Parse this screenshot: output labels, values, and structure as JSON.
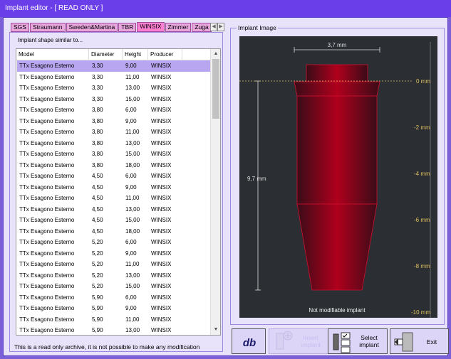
{
  "window": {
    "title": "Implant editor  -  [ READ ONLY ]"
  },
  "tabs": [
    {
      "label": "SGS",
      "active": false
    },
    {
      "label": "Straumann",
      "active": false
    },
    {
      "label": "Sweden&Martina",
      "active": false
    },
    {
      "label": "TBR",
      "active": false
    },
    {
      "label": "WINSIX",
      "active": true
    },
    {
      "label": "Zimmer",
      "active": false
    },
    {
      "label": "Zuga",
      "active": false
    }
  ],
  "left": {
    "subtitle": "Implant shape similar to...",
    "columns": [
      "Model",
      "Diameter",
      "Height",
      "Producer"
    ],
    "rows": [
      [
        "TTx Esagono Esterno",
        "3,30",
        "9,00",
        "WINSIX"
      ],
      [
        "TTx Esagono Esterno",
        "3,30",
        "11,00",
        "WINSIX"
      ],
      [
        "TTx Esagono Esterno",
        "3,30",
        "13,00",
        "WINSIX"
      ],
      [
        "TTx Esagono Esterno",
        "3,30",
        "15,00",
        "WINSIX"
      ],
      [
        "TTx Esagono Esterno",
        "3,80",
        "6,00",
        "WINSIX"
      ],
      [
        "TTx Esagono Esterno",
        "3,80",
        "9,00",
        "WINSIX"
      ],
      [
        "TTx Esagono Esterno",
        "3,80",
        "11,00",
        "WINSIX"
      ],
      [
        "TTx Esagono Esterno",
        "3,80",
        "13,00",
        "WINSIX"
      ],
      [
        "TTx Esagono Esterno",
        "3,80",
        "15,00",
        "WINSIX"
      ],
      [
        "TTx Esagono Esterno",
        "3,80",
        "18,00",
        "WINSIX"
      ],
      [
        "TTx Esagono Esterno",
        "4,50",
        "6,00",
        "WINSIX"
      ],
      [
        "TTx Esagono Esterno",
        "4,50",
        "9,00",
        "WINSIX"
      ],
      [
        "TTx Esagono Esterno",
        "4,50",
        "11,00",
        "WINSIX"
      ],
      [
        "TTx Esagono Esterno",
        "4,50",
        "13,00",
        "WINSIX"
      ],
      [
        "TTx Esagono Esterno",
        "4,50",
        "15,00",
        "WINSIX"
      ],
      [
        "TTx Esagono Esterno",
        "4,50",
        "18,00",
        "WINSIX"
      ],
      [
        "TTx Esagono Esterno",
        "5,20",
        "6,00",
        "WINSIX"
      ],
      [
        "TTx Esagono Esterno",
        "5,20",
        "9,00",
        "WINSIX"
      ],
      [
        "TTx Esagono Esterno",
        "5,20",
        "11,00",
        "WINSIX"
      ],
      [
        "TTx Esagono Esterno",
        "5,20",
        "13,00",
        "WINSIX"
      ],
      [
        "TTx Esagono Esterno",
        "5,20",
        "15,00",
        "WINSIX"
      ],
      [
        "TTx Esagono Esterno",
        "5,90",
        "6,00",
        "WINSIX"
      ],
      [
        "TTx Esagono Esterno",
        "5,90",
        "9,00",
        "WINSIX"
      ],
      [
        "TTx Esagono Esterno",
        "5,90",
        "11,00",
        "WINSIX"
      ],
      [
        "TTx Esagono Esterno",
        "5,90",
        "13,00",
        "WINSIX"
      ]
    ],
    "selected_row": 0,
    "note": "This is a read only archive, it is not possible to make any modification"
  },
  "image_panel": {
    "title": "Implant Image",
    "width_label": "3,7 mm",
    "height_label": "9,7 mm",
    "scale_labels": [
      "0 mm",
      "-2 mm",
      "-4 mm",
      "-6 mm",
      "-8 mm",
      "-10 mm"
    ],
    "caption": "Not modifiable implant"
  },
  "buttons": {
    "db": "db",
    "insert": "Insert\nimplant",
    "select": "Select\nimplant",
    "exit": "Exit"
  },
  "colors": {
    "title_bar": "#6a3ee8",
    "selected_row": "#b9a6f0",
    "active_tab": "#ff7fd2",
    "implant": "#a0001e",
    "scale": "#e0c060"
  }
}
